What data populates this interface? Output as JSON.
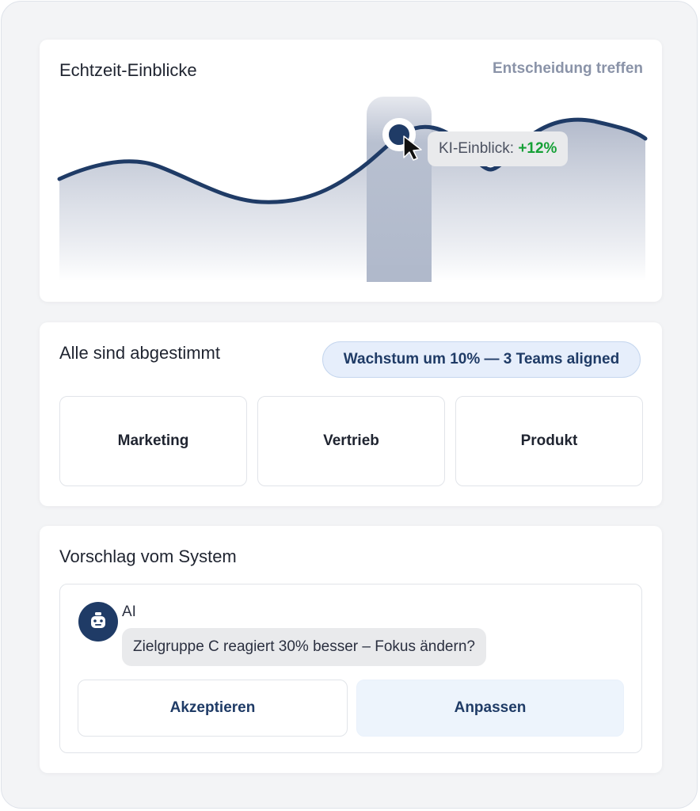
{
  "insights": {
    "title": "Echtzeit-Einblicke",
    "action_link": "Entscheidung treffen",
    "tooltip_label": "KI-Einblick:",
    "tooltip_value": "+12%",
    "line_color": "#1f3b66",
    "accent_positive": "#15a036"
  },
  "alignment": {
    "title": "Alle sind abgestimmt",
    "badge": "Wachstum um 10% — 3 Teams aligned",
    "teams": [
      "Marketing",
      "Vertrieb",
      "Produkt"
    ]
  },
  "suggestion": {
    "title": "Vorschlag vom System",
    "sender": "AI",
    "avatar_icon": "robot-icon",
    "message": "Zielgruppe C reagiert 30% besser – Fokus ändern?",
    "accept_label": "Akzeptieren",
    "adjust_label": "Anpassen"
  }
}
